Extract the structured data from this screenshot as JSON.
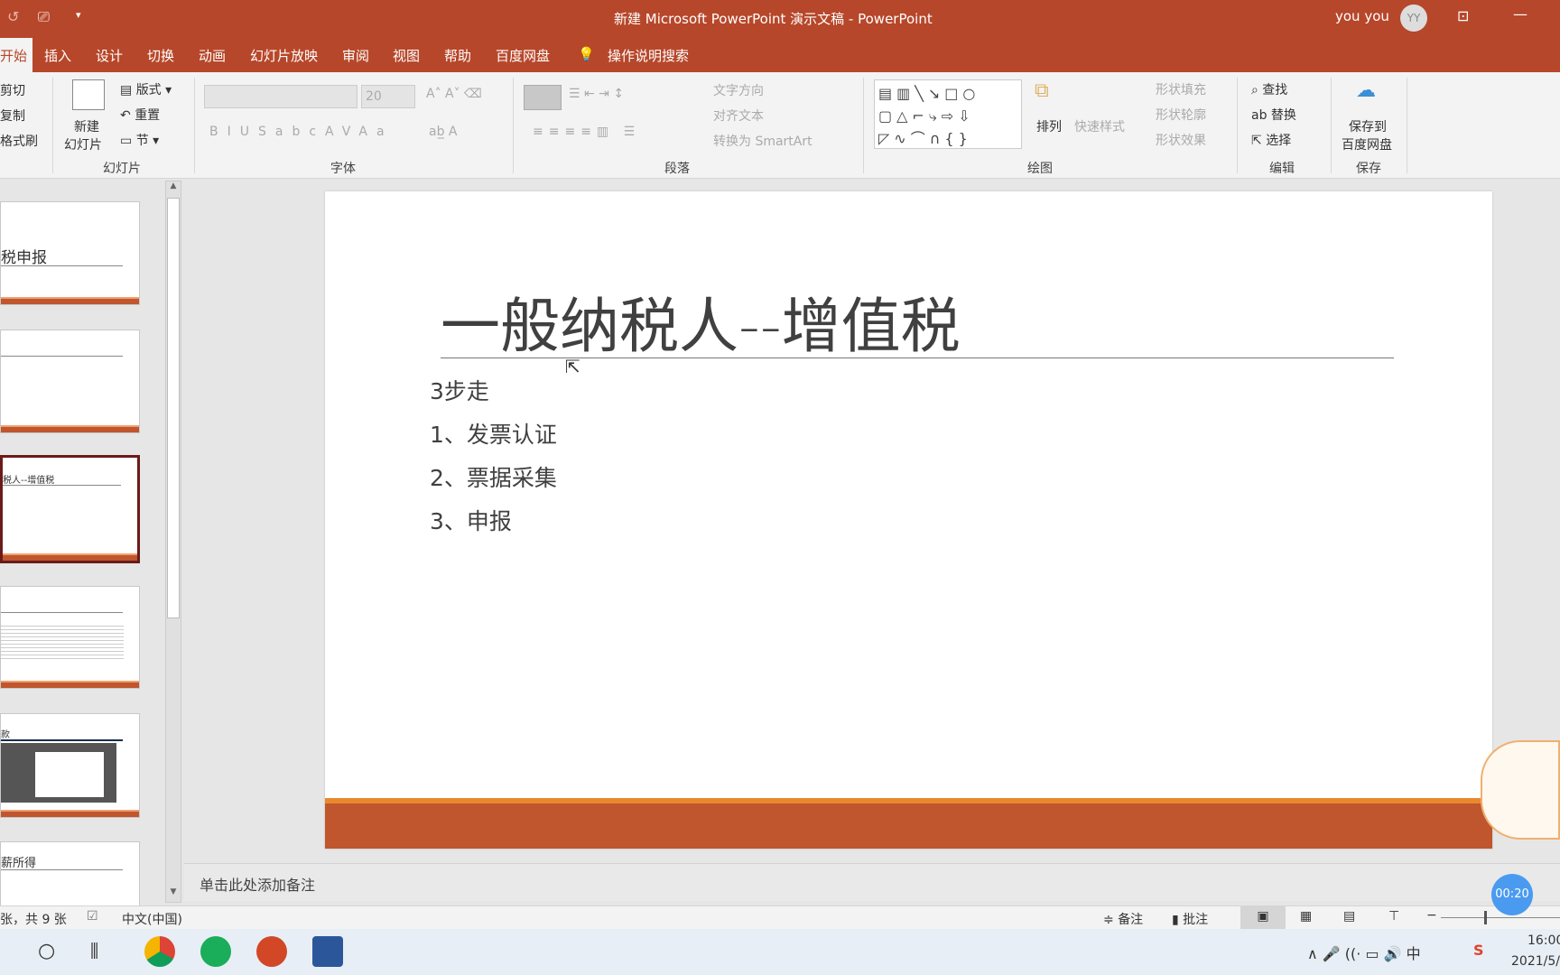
{
  "window": {
    "title": "新建 Microsoft PowerPoint 演示文稿 - PowerPoint",
    "user": "you you",
    "avatar": "YY"
  },
  "tabs": [
    {
      "label": "开始",
      "active": true
    },
    {
      "label": "插入"
    },
    {
      "label": "设计"
    },
    {
      "label": "切换"
    },
    {
      "label": "动画"
    },
    {
      "label": "幻灯片放映"
    },
    {
      "label": "审阅"
    },
    {
      "label": "视图"
    },
    {
      "label": "帮助"
    },
    {
      "label": "百度网盘"
    }
  ],
  "tell_me": "操作说明搜索",
  "ribbon": {
    "clipboard": {
      "cut": "剪切",
      "copy": "复制",
      "format_painter": "格式刷"
    },
    "slides": {
      "new_slide_1": "新建",
      "new_slide_2": "幻灯片",
      "layout": "版式",
      "reset": "重置",
      "section": "节",
      "group": "幻灯片"
    },
    "font": {
      "font_name": "",
      "font_size": "20",
      "group": "字体"
    },
    "paragraph": {
      "text_direction": "文字方向",
      "align_text": "对齐文本",
      "smartart": "转换为 SmartArt",
      "group": "段落"
    },
    "drawing": {
      "arrange": "排列",
      "quick_styles": "快速样式",
      "shape_fill": "形状填充",
      "shape_outline": "形状轮廓",
      "shape_effects": "形状效果",
      "group": "绘图"
    },
    "editing": {
      "find": "查找",
      "replace": "替换",
      "select": "选择",
      "group": "编辑"
    },
    "save": {
      "save_1": "保存到",
      "save_2": "百度网盘",
      "group": "保存"
    }
  },
  "thumbnails": [
    {
      "title": "税申报"
    },
    {
      "title": ""
    },
    {
      "title": "税人--增值税",
      "selected": true
    },
    {
      "title": ""
    },
    {
      "title": "款"
    },
    {
      "title": "薪所得"
    }
  ],
  "slide": {
    "title": "一般纳税人--增值税",
    "body": [
      "3步走",
      "1、发票认证",
      "2、票据采集",
      "3、申报"
    ],
    "accent": "#c0562d"
  },
  "notes_placeholder": "单击此处添加备注",
  "status": {
    "slide_count": "张，共 9 张",
    "language": "中文(中国)",
    "notes": "备注",
    "comments": "批注"
  },
  "timer": "00:20",
  "clock": {
    "time": "16:00",
    "date": "2021/5/"
  }
}
